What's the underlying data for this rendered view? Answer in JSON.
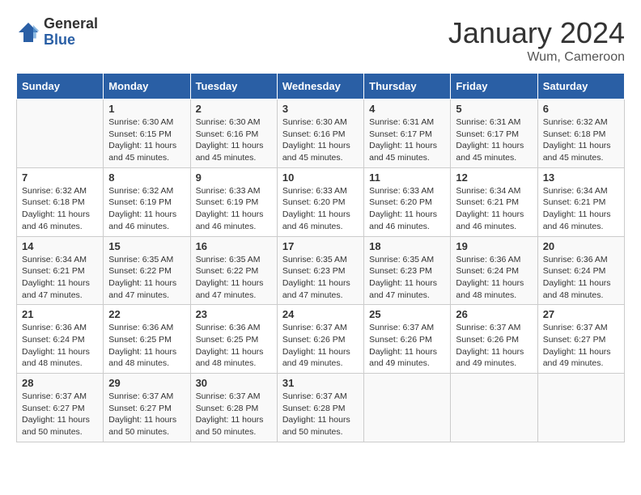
{
  "logo": {
    "general": "General",
    "blue": "Blue"
  },
  "title": "January 2024",
  "location": "Wum, Cameroon",
  "headers": [
    "Sunday",
    "Monday",
    "Tuesday",
    "Wednesday",
    "Thursday",
    "Friday",
    "Saturday"
  ],
  "weeks": [
    [
      {
        "day": "",
        "info": ""
      },
      {
        "day": "1",
        "info": "Sunrise: 6:30 AM\nSunset: 6:15 PM\nDaylight: 11 hours and 45 minutes."
      },
      {
        "day": "2",
        "info": "Sunrise: 6:30 AM\nSunset: 6:16 PM\nDaylight: 11 hours and 45 minutes."
      },
      {
        "day": "3",
        "info": "Sunrise: 6:30 AM\nSunset: 6:16 PM\nDaylight: 11 hours and 45 minutes."
      },
      {
        "day": "4",
        "info": "Sunrise: 6:31 AM\nSunset: 6:17 PM\nDaylight: 11 hours and 45 minutes."
      },
      {
        "day": "5",
        "info": "Sunrise: 6:31 AM\nSunset: 6:17 PM\nDaylight: 11 hours and 45 minutes."
      },
      {
        "day": "6",
        "info": "Sunrise: 6:32 AM\nSunset: 6:18 PM\nDaylight: 11 hours and 45 minutes."
      }
    ],
    [
      {
        "day": "7",
        "info": "Sunrise: 6:32 AM\nSunset: 6:18 PM\nDaylight: 11 hours and 46 minutes."
      },
      {
        "day": "8",
        "info": "Sunrise: 6:32 AM\nSunset: 6:19 PM\nDaylight: 11 hours and 46 minutes."
      },
      {
        "day": "9",
        "info": "Sunrise: 6:33 AM\nSunset: 6:19 PM\nDaylight: 11 hours and 46 minutes."
      },
      {
        "day": "10",
        "info": "Sunrise: 6:33 AM\nSunset: 6:20 PM\nDaylight: 11 hours and 46 minutes."
      },
      {
        "day": "11",
        "info": "Sunrise: 6:33 AM\nSunset: 6:20 PM\nDaylight: 11 hours and 46 minutes."
      },
      {
        "day": "12",
        "info": "Sunrise: 6:34 AM\nSunset: 6:21 PM\nDaylight: 11 hours and 46 minutes."
      },
      {
        "day": "13",
        "info": "Sunrise: 6:34 AM\nSunset: 6:21 PM\nDaylight: 11 hours and 46 minutes."
      }
    ],
    [
      {
        "day": "14",
        "info": "Sunrise: 6:34 AM\nSunset: 6:21 PM\nDaylight: 11 hours and 47 minutes."
      },
      {
        "day": "15",
        "info": "Sunrise: 6:35 AM\nSunset: 6:22 PM\nDaylight: 11 hours and 47 minutes."
      },
      {
        "day": "16",
        "info": "Sunrise: 6:35 AM\nSunset: 6:22 PM\nDaylight: 11 hours and 47 minutes."
      },
      {
        "day": "17",
        "info": "Sunrise: 6:35 AM\nSunset: 6:23 PM\nDaylight: 11 hours and 47 minutes."
      },
      {
        "day": "18",
        "info": "Sunrise: 6:35 AM\nSunset: 6:23 PM\nDaylight: 11 hours and 47 minutes."
      },
      {
        "day": "19",
        "info": "Sunrise: 6:36 AM\nSunset: 6:24 PM\nDaylight: 11 hours and 48 minutes."
      },
      {
        "day": "20",
        "info": "Sunrise: 6:36 AM\nSunset: 6:24 PM\nDaylight: 11 hours and 48 minutes."
      }
    ],
    [
      {
        "day": "21",
        "info": "Sunrise: 6:36 AM\nSunset: 6:24 PM\nDaylight: 11 hours and 48 minutes."
      },
      {
        "day": "22",
        "info": "Sunrise: 6:36 AM\nSunset: 6:25 PM\nDaylight: 11 hours and 48 minutes."
      },
      {
        "day": "23",
        "info": "Sunrise: 6:36 AM\nSunset: 6:25 PM\nDaylight: 11 hours and 48 minutes."
      },
      {
        "day": "24",
        "info": "Sunrise: 6:37 AM\nSunset: 6:26 PM\nDaylight: 11 hours and 49 minutes."
      },
      {
        "day": "25",
        "info": "Sunrise: 6:37 AM\nSunset: 6:26 PM\nDaylight: 11 hours and 49 minutes."
      },
      {
        "day": "26",
        "info": "Sunrise: 6:37 AM\nSunset: 6:26 PM\nDaylight: 11 hours and 49 minutes."
      },
      {
        "day": "27",
        "info": "Sunrise: 6:37 AM\nSunset: 6:27 PM\nDaylight: 11 hours and 49 minutes."
      }
    ],
    [
      {
        "day": "28",
        "info": "Sunrise: 6:37 AM\nSunset: 6:27 PM\nDaylight: 11 hours and 50 minutes."
      },
      {
        "day": "29",
        "info": "Sunrise: 6:37 AM\nSunset: 6:27 PM\nDaylight: 11 hours and 50 minutes."
      },
      {
        "day": "30",
        "info": "Sunrise: 6:37 AM\nSunset: 6:28 PM\nDaylight: 11 hours and 50 minutes."
      },
      {
        "day": "31",
        "info": "Sunrise: 6:37 AM\nSunset: 6:28 PM\nDaylight: 11 hours and 50 minutes."
      },
      {
        "day": "",
        "info": ""
      },
      {
        "day": "",
        "info": ""
      },
      {
        "day": "",
        "info": ""
      }
    ]
  ]
}
